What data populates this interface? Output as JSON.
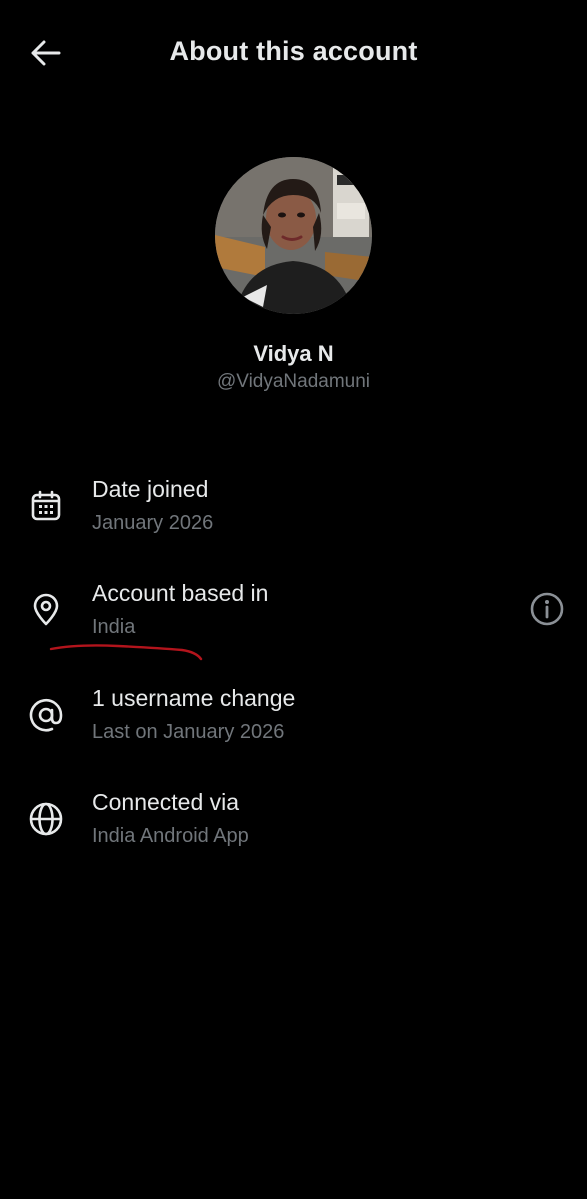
{
  "header": {
    "back_icon": "arrow-left-icon",
    "title": "About this account"
  },
  "profile": {
    "display_name": "Vidya N",
    "handle": "@VidyaNadamuni"
  },
  "rows": [
    {
      "icon": "calendar-icon",
      "title": "Date joined",
      "subtitle": "January 2026"
    },
    {
      "icon": "location-pin-icon",
      "title": "Account based in",
      "subtitle": "India",
      "trailing_icon": "info-icon"
    },
    {
      "icon": "at-sign-icon",
      "title": "1 username change",
      "subtitle": "Last on January 2026"
    },
    {
      "icon": "globe-icon",
      "title": "Connected via",
      "subtitle": "India Android App"
    }
  ],
  "colors": {
    "background": "#000000",
    "primary_text": "#e7e9ea",
    "secondary_text": "#71767b",
    "annotation_stroke": "#b3141c"
  }
}
